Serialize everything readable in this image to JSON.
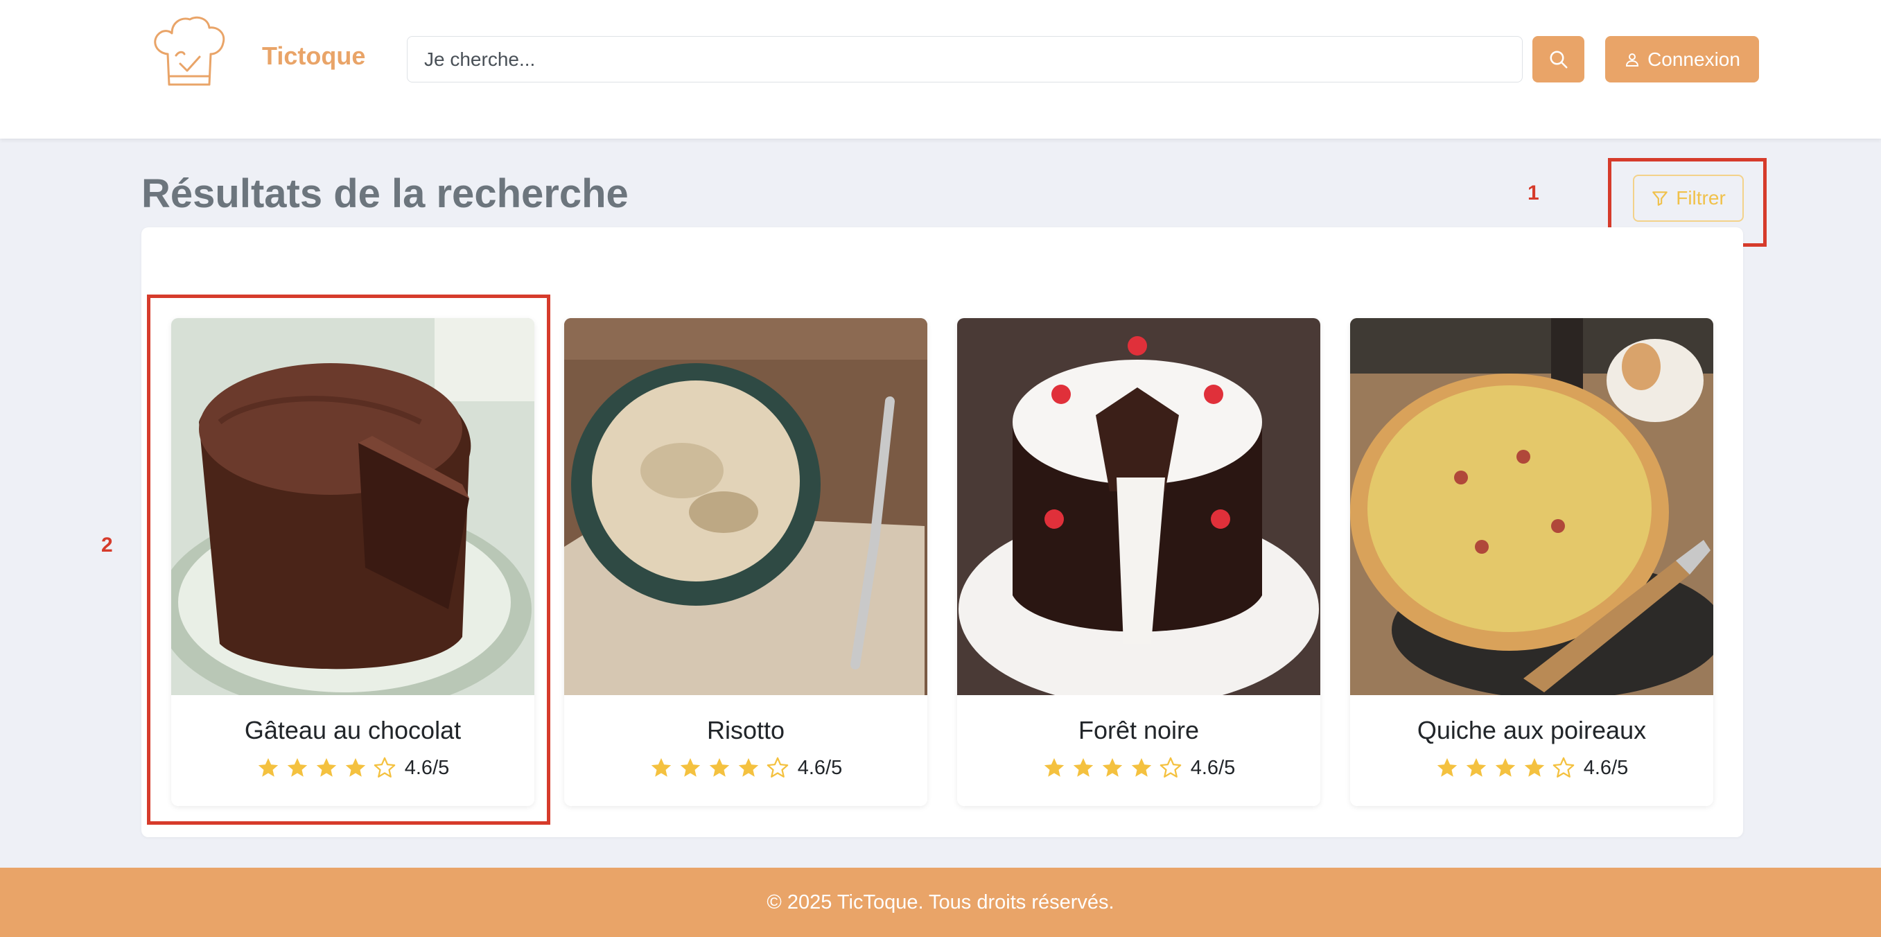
{
  "header": {
    "brand": "Tictoque",
    "search": {
      "placeholder": "Je cherche...",
      "value": ""
    },
    "login_label": "Connexion"
  },
  "main": {
    "title": "Résultats de la recherche",
    "filter_label": "Filtrer",
    "annotations": [
      "1",
      "2"
    ],
    "recipes": [
      {
        "name": "Gâteau au chocolat",
        "rating_text": "4.6/5",
        "stars": 4,
        "image": "chocolate-cake"
      },
      {
        "name": "Risotto",
        "rating_text": "4.6/5",
        "stars": 4,
        "image": "risotto-bowl"
      },
      {
        "name": "Forêt noire",
        "rating_text": "4.6/5",
        "stars": 4,
        "image": "black-forest-cake"
      },
      {
        "name": "Quiche aux poireaux",
        "rating_text": "4.6/5",
        "stars": 4,
        "image": "leek-quiche"
      }
    ]
  },
  "footer": {
    "text": "© 2025 TicToque. Tous droits réservés."
  },
  "colors": {
    "accent": "#e9a468",
    "star": "#f4c13f",
    "annotation": "#d63b2b",
    "filter": "#f0c14b"
  }
}
